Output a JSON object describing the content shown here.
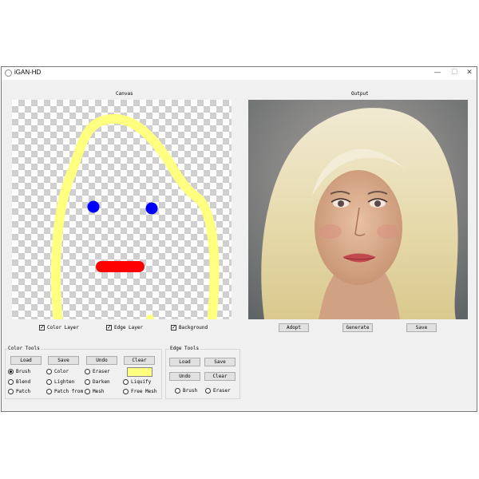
{
  "window": {
    "title": "iGAN-HD",
    "minimize_icon": "—",
    "maximize_icon": "☐",
    "close_icon": "✕"
  },
  "canvas": {
    "heading": "Canvas",
    "stroke_colors": {
      "outline": "#ffff80",
      "eyes": "#0000ff",
      "mouth": "#ff0000"
    }
  },
  "output": {
    "heading": "Output"
  },
  "layers": {
    "color_layer": {
      "label": "Color Layer",
      "checked": true
    },
    "edge_layer": {
      "label": "Edge Layer",
      "checked": true
    },
    "background": {
      "label": "Background",
      "checked": true
    }
  },
  "output_buttons": {
    "adopt": "Adopt",
    "generate": "Generate",
    "save": "Save"
  },
  "color_tools": {
    "title": "Color Tools",
    "buttons": {
      "load": "Load",
      "save": "Save",
      "undo": "Undo",
      "clear": "Clear"
    },
    "radios": {
      "brush": "Brush",
      "color": "Color",
      "eraser": "Eraser",
      "blend": "Blend",
      "lighten": "Lighten",
      "darken": "Darken",
      "liquify": "Liquify",
      "patch": "Patch",
      "patch_from": "Patch from",
      "mesh": "Mesh",
      "free_mesh": "Free Mesh"
    },
    "selected": "Brush",
    "swatch_color": "#ffff80"
  },
  "edge_tools": {
    "title": "Edge Tools",
    "buttons": {
      "load": "Load",
      "save": "Save",
      "undo": "Undo",
      "clear": "Clear"
    },
    "radios": {
      "brush": "Brush",
      "eraser": "Eraser"
    }
  }
}
